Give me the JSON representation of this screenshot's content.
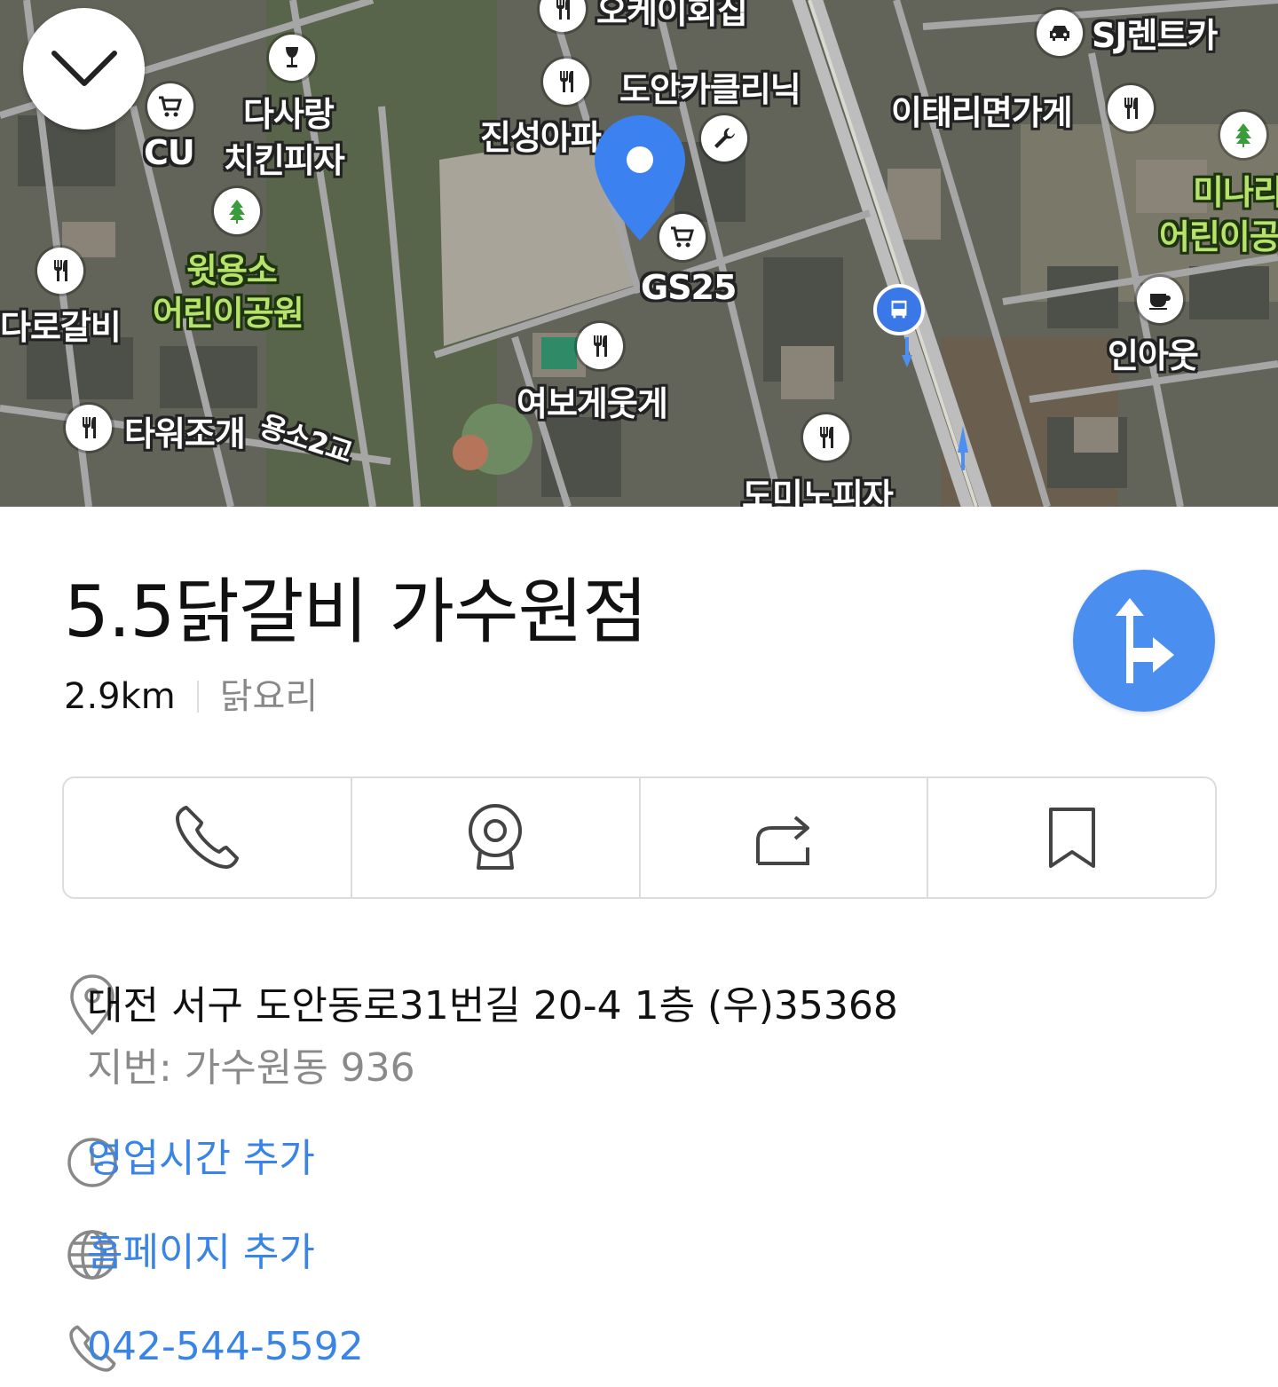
{
  "map": {
    "labels": {
      "okei": "오케이회집",
      "sj": "SJ렌트카",
      "dasarang": "다사랑",
      "chicken": "치킨피자",
      "cu": "CU",
      "doan": "도안카클리닉",
      "jinseong": "진성아파",
      "italy": "이태리면가게",
      "minari1": "미나리",
      "minari2": "어린이공",
      "wit1": "윗용소",
      "wit2": "어린이공원",
      "gs25": "GS25",
      "darogalbi": "다로갈비",
      "inout": "인아웃",
      "yeobo": "여보게웃게",
      "tower": "타워조개",
      "bridge": "용소2교",
      "domino": "도미노피자"
    },
    "pin_color": "#3b82f0"
  },
  "place": {
    "name": "5.5닭갈비 가수원점",
    "distance": "2.9km",
    "category": "닭요리",
    "address": "대전 서구 도안동로31번길 20-4 1층 (우)35368",
    "lot_address": "지번: 가수원동 936",
    "hours_link": "영업시간 추가",
    "homepage_link": "홈페이지 추가",
    "phone": "042-544-5592"
  },
  "colors": {
    "accent": "#4a8ff0",
    "link": "#3a84e6"
  }
}
